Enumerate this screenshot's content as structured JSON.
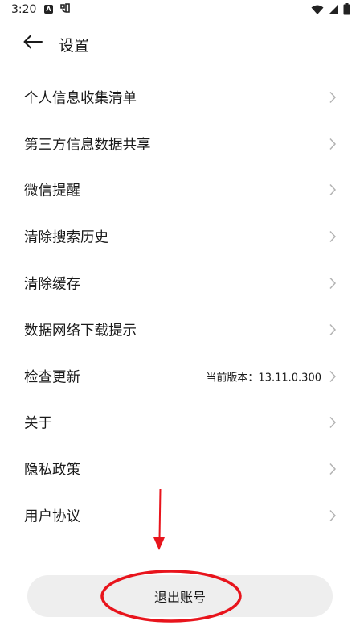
{
  "status_bar": {
    "time": "3:20",
    "icons": [
      "notification-a-icon",
      "app-notification-icon",
      "wifi-icon",
      "signal-icon",
      "battery-icon"
    ]
  },
  "header": {
    "title": "设置",
    "back_icon": "arrow-left-icon"
  },
  "settings": {
    "items": [
      {
        "label": "个人信息收集清单",
        "value": ""
      },
      {
        "label": "第三方信息数据共享",
        "value": ""
      },
      {
        "label": "微信提醒",
        "value": ""
      },
      {
        "label": "清除搜索历史",
        "value": ""
      },
      {
        "label": "清除缓存",
        "value": ""
      },
      {
        "label": "数据网络下载提示",
        "value": ""
      },
      {
        "label": "检查更新",
        "value": "当前版本：13.11.0.300"
      },
      {
        "label": "关于",
        "value": ""
      },
      {
        "label": "隐私政策",
        "value": ""
      },
      {
        "label": "用户协议",
        "value": ""
      }
    ]
  },
  "logout": {
    "label": "退出账号"
  },
  "colors": {
    "annotation": "#e8141c",
    "button_bg": "#eeeeee",
    "chevron": "#b3b3b3"
  }
}
